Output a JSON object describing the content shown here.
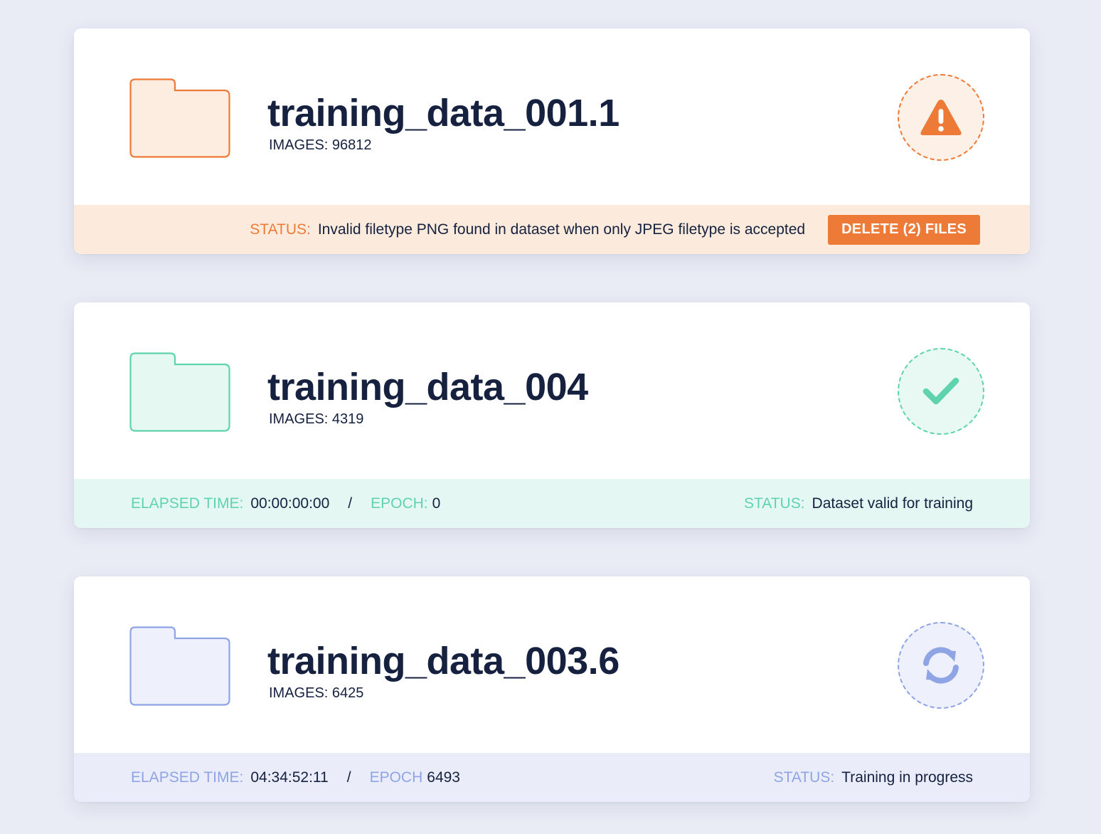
{
  "colors": {
    "warning": "#ee7a37",
    "success": "#5fd3ae",
    "progress": "#8ea4e4",
    "text": "#15213f",
    "background": "#e9ecf5"
  },
  "cards": [
    {
      "title": "training_data_001.1",
      "images": "IMAGES: 96812",
      "status_icon": "warning-icon",
      "status_label": "STATUS:",
      "status_text": "Invalid filetype PNG found in dataset when only JPEG filetype is accepted",
      "action_label": "DELETE (2) FILES"
    },
    {
      "title": "training_data_004",
      "images": "IMAGES: 4319",
      "status_icon": "check-icon",
      "elapsed_label": "ELAPSED TIME:",
      "elapsed_value": "00:00:00:00",
      "separator": "/",
      "epoch_label": "EPOCH:",
      "epoch_value": "0",
      "status_label": "STATUS:",
      "status_text": "Dataset valid for training"
    },
    {
      "title": "training_data_003.6",
      "images": "IMAGES: 6425",
      "status_icon": "sync-icon",
      "elapsed_label": "ELAPSED TIME:",
      "elapsed_value": "04:34:52:11",
      "separator": "/",
      "epoch_label": "EPOCH",
      "epoch_value": "6493",
      "status_label": "STATUS:",
      "status_text": "Training in progress"
    }
  ]
}
